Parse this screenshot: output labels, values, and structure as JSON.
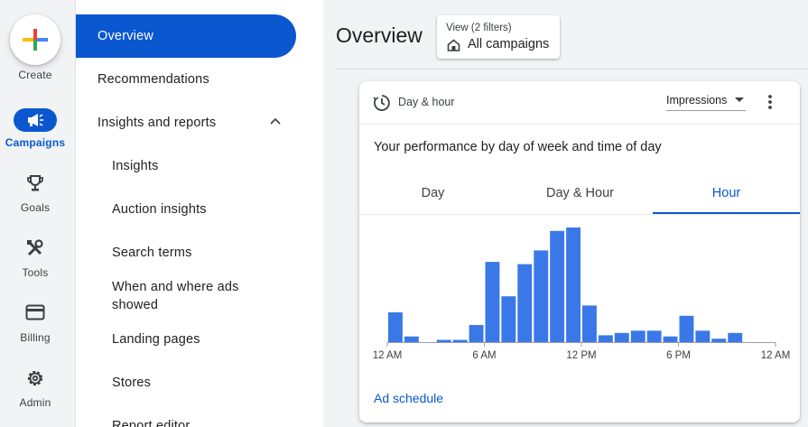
{
  "rail": {
    "create": "Create",
    "items": [
      {
        "label": "Campaigns",
        "icon": "megaphone-icon",
        "active": true
      },
      {
        "label": "Goals",
        "icon": "trophy-icon"
      },
      {
        "label": "Tools",
        "icon": "tools-icon"
      },
      {
        "label": "Billing",
        "icon": "credit-card-icon"
      },
      {
        "label": "Admin",
        "icon": "gear-icon"
      }
    ]
  },
  "nav": {
    "overview": "Overview",
    "recommendations": "Recommendations",
    "insights_reports": "Insights and reports",
    "insights": "Insights",
    "auction_insights": "Auction insights",
    "search_terms": "Search terms",
    "when_where": "When and where ads showed",
    "landing_pages": "Landing pages",
    "stores": "Stores",
    "report_editor": "Report editor"
  },
  "header": {
    "title": "Overview",
    "view_label": "View (2 filters)",
    "view_value": "All campaigns"
  },
  "card": {
    "title": "Day & hour",
    "metric": "Impressions",
    "subtitle": "Your performance by day of week and time of day",
    "tabs": [
      "Day",
      "Day & Hour",
      "Hour"
    ],
    "active_tab": "Hour",
    "link": "Ad schedule"
  },
  "colors": {
    "accent": "#0b57d0",
    "bar": "#3b78e7"
  },
  "chart_data": {
    "type": "bar",
    "categories": [
      "0",
      "1",
      "2",
      "3",
      "4",
      "5",
      "6",
      "7",
      "8",
      "9",
      "10",
      "11",
      "12",
      "13",
      "14",
      "15",
      "16",
      "17",
      "18",
      "19",
      "20",
      "21",
      "22",
      "23"
    ],
    "values": [
      26,
      5,
      0,
      2,
      2,
      15,
      70,
      40,
      68,
      80,
      97,
      100,
      32,
      6,
      8,
      10,
      10,
      5,
      23,
      10,
      3,
      8,
      0,
      0
    ],
    "tick_labels": [
      "12 AM",
      "6 AM",
      "12 PM",
      "6 PM",
      "12 AM"
    ],
    "ylim": [
      0,
      100
    ],
    "grid": false
  }
}
